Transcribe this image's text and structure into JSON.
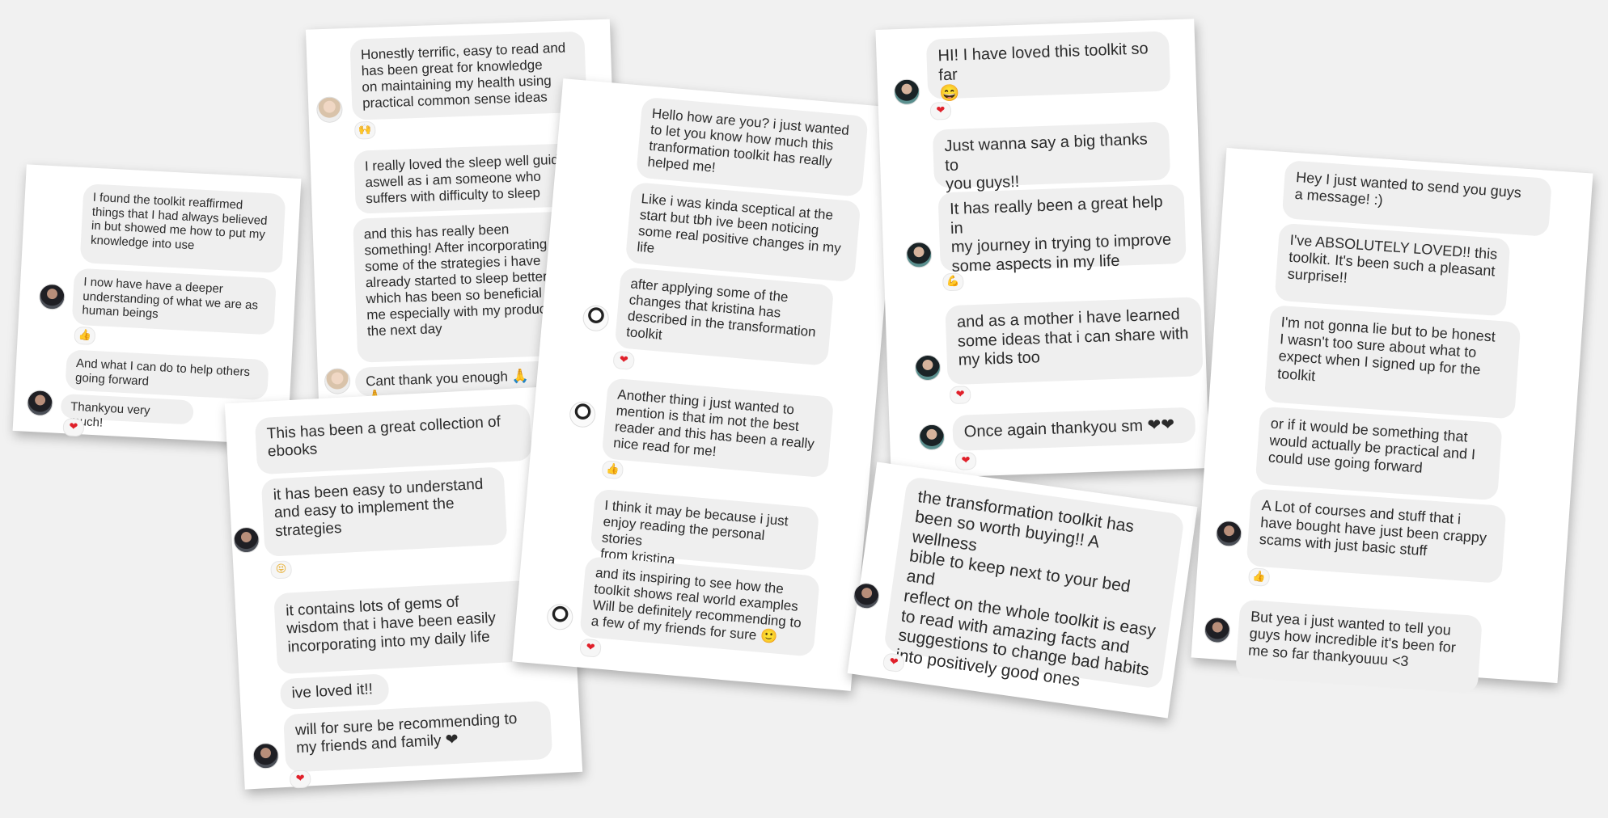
{
  "cards": {
    "c1": {
      "m1": "I found the toolkit reaffirmed\nthings that I had always believed\nin but showed me how to put my\nknowledge into use",
      "m2": "I now have have a deeper\nunderstanding of what we are as\nhuman beings",
      "m3": "And what I can do to help others\ngoing forward",
      "m4": "Thankyou very much!"
    },
    "c2": {
      "m1": "Honestly terrific, easy to read and\nhas been great for knowledge\non maintaining my health using\npractical common sense ideas",
      "m2": "I really loved the sleep well guide\naswell as i am someone who\nsuffers with difficulty to sleep",
      "m3": "and this has really been\nsomething! After incorporating\nsome of the strategies i have\nalready started to sleep better\nwhich has been so beneficial for\nme especially with my productivity\nthe next day",
      "m4": "Cant thank you enough 🙏🙏"
    },
    "c3": {
      "m1": "This has been a great collection of\nebooks",
      "m2": "it has been easy to understand\nand easy to implement the\nstrategies",
      "m3": "it contains lots of gems of\nwisdom that i have been easily\nincorporating into my daily life",
      "m4": "ive loved it!!",
      "m5": "will for sure be recommending to\nmy friends and family ❤"
    },
    "c4": {
      "m1": "Hello how are you? i just wanted\nto let you know how much this\ntranformation toolkit has really\nhelped me!",
      "m2": "Like i was kinda sceptical at the\nstart but tbh ive been noticing\nsome real positive changes in my\nlife",
      "m3": "after applying some of the\nchanges that kristina has\ndescribed in the transformation\ntoolkit",
      "m4": "Another thing i just wanted to\nmention is that im not the best\nreader and this has been a really\nnice read for me!",
      "m5": "I think it may be because i just\nenjoy reading the personal stories\nfrom kristina",
      "m6": "and its inspiring to see how the\ntoolkit shows real world examples\nWill be definitely recommending to\na few of my friends for sure 🙂"
    },
    "c5": {
      "m1": "HI! I have loved this toolkit so far\n😄",
      "m2": "Just wanna say a big thanks to\nyou guys!!",
      "m3": "It has really been a great help in\nmy journey in trying to improve\nsome aspects in my life",
      "m4": "and as a mother i have learned\nsome ideas that i can share with\nmy kids too",
      "m5": "Once again thankyou sm ❤❤"
    },
    "c6": {
      "m1": "the transformation toolkit has\nbeen so worth buying!! A wellness\nbible to keep next to your bed and\nreflect on the whole toolkit is easy\nto read with amazing facts and\nsuggestions to change bad habits\ninto positively good ones"
    },
    "c7": {
      "m1": "Hey I just wanted to send you guys\na message! :)",
      "m2": "I've ABSOLUTELY LOVED!! this\ntoolkit. It's been such a pleasant\nsurprise!!",
      "m3": "I'm not gonna lie but to be honest\nI wasn't too sure about what to\nexpect when I signed up for the\ntoolkit",
      "m4": "or if it would be something that\nwould actually be practical and I\ncould use going forward",
      "m5": "A Lot of courses and stuff that i\nhave bought have just been crappy\nscams with just basic stuff",
      "m6": "But yea i just wanted to tell you\nguys how incredible it's been for\nme so far thankyouuu <3"
    }
  },
  "reactions": {
    "heart": "❤",
    "thumb": "👍",
    "hands": "🙌",
    "tongue": "😝",
    "muscle": "💪"
  },
  "colors": {
    "background": "#f1f1f1",
    "card": "#ffffff",
    "bubble": "#efefef",
    "heart": "#e0202a"
  }
}
